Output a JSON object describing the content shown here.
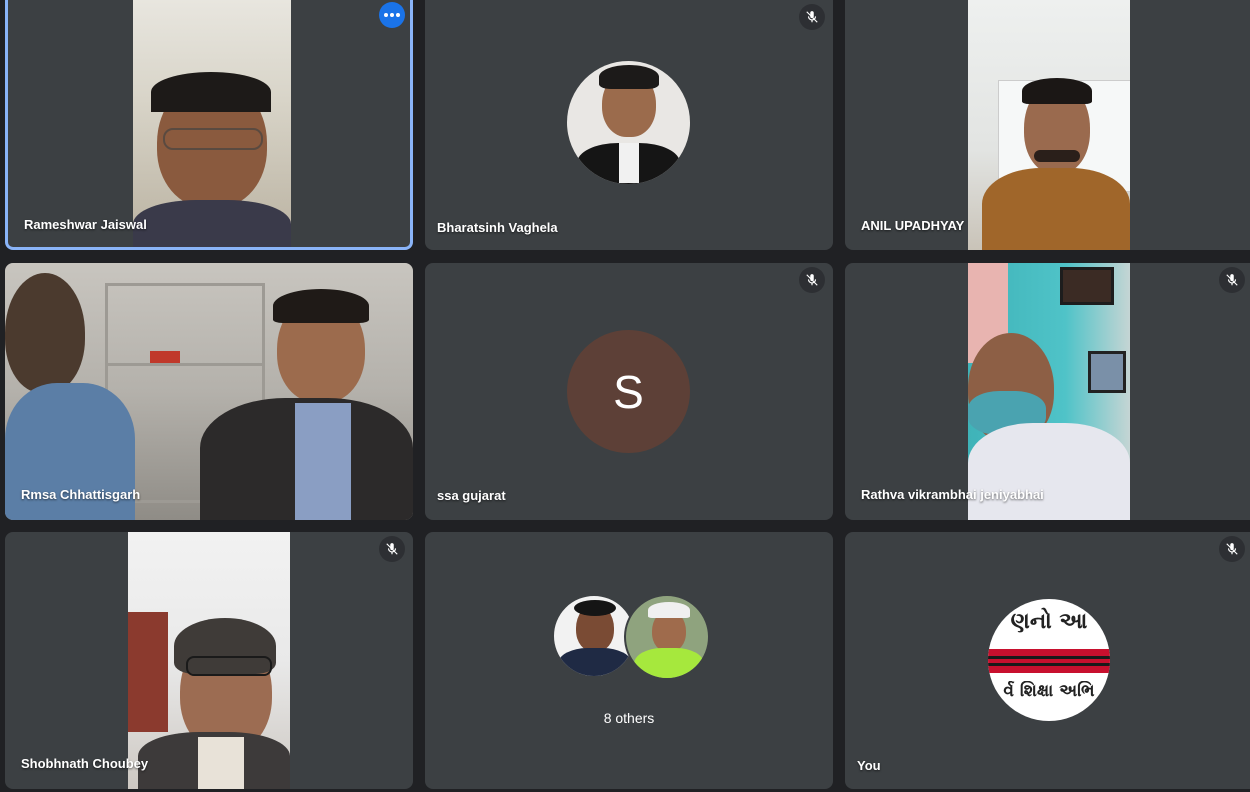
{
  "participants": [
    {
      "name": "Rameshwar Jaiswal"
    },
    {
      "name": "Bharatsinh Vaghela"
    },
    {
      "name": "ANIL UPADHYAY"
    },
    {
      "name": "Rmsa Chhattisgarh"
    },
    {
      "name": "ssa gujarat",
      "initial": "S"
    },
    {
      "name": "Rathva vikrambhai jeniyabhai"
    },
    {
      "name": "Shobhnath Choubey"
    },
    {
      "others_label": "8 others"
    },
    {
      "name": "You",
      "avatar_text_top": "ણનો આ",
      "avatar_text_bottom": "ર્વ શિક્ષા અભિ"
    }
  ],
  "colors": {
    "tile": "#3c4043",
    "background": "#202124",
    "active_border": "#8ab4f8",
    "menu": "#1a73e8",
    "initial_avatar": "#5d4037"
  },
  "icons": {
    "mic_off": "mic-off-icon",
    "more": "more-options-icon"
  }
}
